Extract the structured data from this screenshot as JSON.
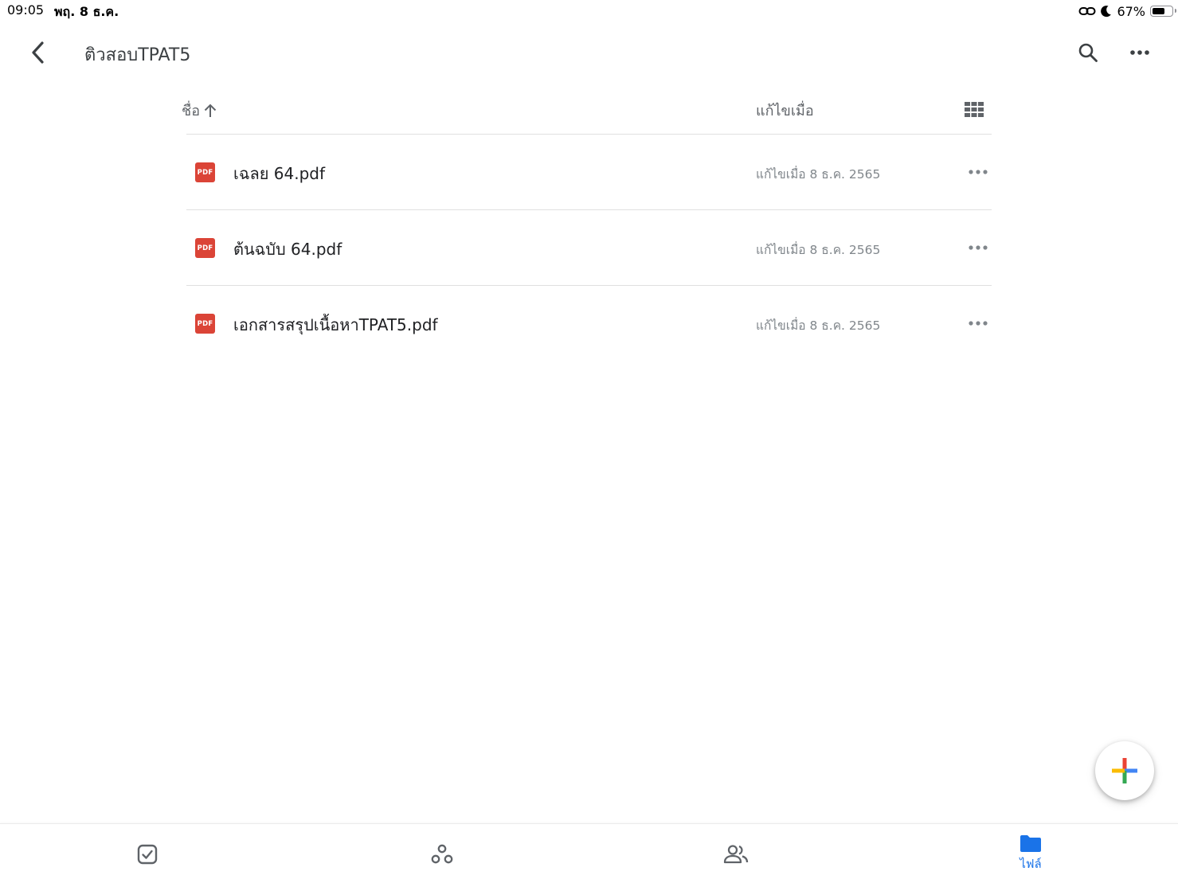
{
  "status_bar": {
    "time": "09:05",
    "date": "พฤ. 8 ธ.ค.",
    "battery_percent": "67%",
    "battery_level": 0.67,
    "icons": [
      "link-icon",
      "moon-icon",
      "battery-icon"
    ]
  },
  "header": {
    "title": "ติวสอบTPAT5",
    "back_icon": "chevron-left-icon",
    "search_icon": "search-icon",
    "more_icon": "more-horizontal-icon"
  },
  "list_header": {
    "sort_label": "ชื่อ",
    "sort_direction_icon": "arrow-up-icon",
    "modified_label": "แก้ไขเมื่อ",
    "view_toggle_icon": "grid-view-icon"
  },
  "files": [
    {
      "name": "เฉลย 64.pdf",
      "type_badge": "PDF",
      "modified": "แก้ไขเมื่อ 8 ธ.ค. 2565"
    },
    {
      "name": "ต้นฉบับ 64.pdf",
      "type_badge": "PDF",
      "modified": "แก้ไขเมื่อ 8 ธ.ค. 2565"
    },
    {
      "name": "เอกสารสรุปเนื้อหาTPAT5.pdf",
      "type_badge": "PDF",
      "modified": "แก้ไขเมื่อ 8 ธ.ค. 2565"
    }
  ],
  "fab": {
    "icon": "plus-icon",
    "colors": [
      "#ea4335",
      "#fbbc04",
      "#34a853",
      "#4285f4"
    ]
  },
  "bottom_nav": {
    "items": [
      {
        "icon": "priority-check-icon",
        "label": ""
      },
      {
        "icon": "workspaces-icon",
        "label": ""
      },
      {
        "icon": "shared-people-icon",
        "label": ""
      },
      {
        "icon": "folder-icon",
        "label": "ไฟล์",
        "active": true
      }
    ],
    "active_color": "#1a73e8",
    "inactive_color": "#5f6368"
  },
  "colors": {
    "pdf_red": "#db4437",
    "text_primary": "#202124",
    "text_secondary": "#5f6368",
    "divider": "#e0e0e0"
  }
}
